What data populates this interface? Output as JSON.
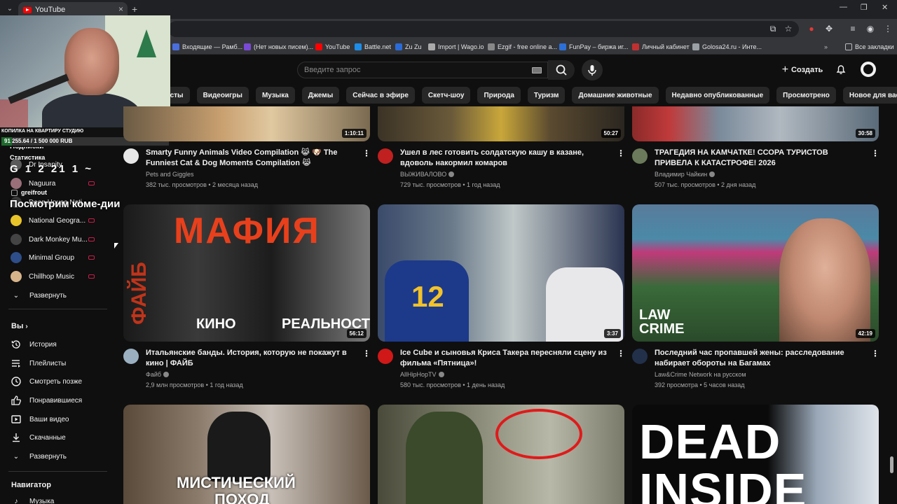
{
  "browser": {
    "tab_title": "YouTube",
    "new_tab": "+",
    "bookmarks": [
      {
        "label": "Входящие — Рамб...",
        "color": "#4a6fdc"
      },
      {
        "label": "(Нет новых писем)...",
        "color": "#7a4ad6"
      },
      {
        "label": "YouTube",
        "color": "#ff0000"
      },
      {
        "label": "Battle.net",
        "color": "#1c8ee8"
      },
      {
        "label": "Zu Zu",
        "color": "#2a6bd8"
      },
      {
        "label": "Import | Wago.io",
        "color": "#aaaaaa"
      },
      {
        "label": "Ezgif - free online a...",
        "color": "#888888"
      },
      {
        "label": "FunPay – биржа иг...",
        "color": "#2c6fd6"
      },
      {
        "label": "Личный кабинет",
        "color": "#c03030"
      },
      {
        "label": "Golosa24.ru - Инте...",
        "color": "#9aa0a6"
      }
    ],
    "all_bookmarks": "Все закладки"
  },
  "header": {
    "search_placeholder": "Введите запрос",
    "create_label": "Создать"
  },
  "chips": [
    "касты",
    "Видеоигры",
    "Музыка",
    "Джемы",
    "Сейчас в эфире",
    "Скетч-шоу",
    "Природа",
    "Туризм",
    "Домашние животные",
    "Недавно опубликованные",
    "Просмотрено",
    "Новое для вас"
  ],
  "overlay": {
    "goal_title": "КОПИЛКА НА КВАРТИРУ СТУДИЮ",
    "goal_amount": "91 255.64 / 1 500 000 RUB",
    "goal_fraction": 0.061,
    "stats_label": "Статистика",
    "stats_digits": "G 1 2 21 1 ~",
    "user_name": "greifrout",
    "big_text": "Посмотрим коме-дии"
  },
  "sidebar": {
    "subscriptions_header": "Подписки",
    "subscriptions": [
      {
        "label": "Dr Insanity",
        "color": "#5a5a5a"
      },
      {
        "label": "Naguura",
        "color": "#9a6f7a"
      },
      {
        "label": "Deep House Nati...",
        "color": "#3a3a3a"
      },
      {
        "label": "National Geogra...",
        "color": "#e8c32a"
      },
      {
        "label": "Dark Monkey Mu...",
        "color": "#444444"
      },
      {
        "label": "Minimal Group",
        "color": "#2d4e8a"
      },
      {
        "label": "Chillhop Music",
        "color": "#d8b48a"
      }
    ],
    "expand_label": "Развернуть",
    "you_section": "Вы",
    "you_items": [
      {
        "label": "История",
        "icon": "history-icon"
      },
      {
        "label": "Плейлисты",
        "icon": "playlists-icon"
      },
      {
        "label": "Смотреть позже",
        "icon": "watch-later-icon"
      },
      {
        "label": "Понравившиеся",
        "icon": "like-icon"
      },
      {
        "label": "Ваши видео",
        "icon": "your-videos-icon"
      },
      {
        "label": "Скачанные",
        "icon": "download-icon"
      },
      {
        "label": "Развернуть",
        "icon": "chevron-down-icon"
      }
    ],
    "navigator_section": "Навигатор",
    "navigator_items": [
      {
        "label": "Музыка",
        "icon": "music-icon"
      }
    ]
  },
  "videos": [
    {
      "title": "Smarty Funny Animals Video Compilation 😹 🐶 The Funniest Cat & Dog Moments Compilation 😹",
      "channel": "Pets and Giggles",
      "verified": false,
      "meta": "382 тыс. просмотров • 2 месяца назад",
      "duration": "1:10:11",
      "avatar": "#e8e8e8"
    },
    {
      "title": "Ушел в лес готовить солдатскую кашу в казане, вдоволь накормил комаров",
      "channel": "ВЫЖИВАЛОВО",
      "verified": true,
      "meta": "729 тыс. просмотров • 1 год назад",
      "duration": "50:27",
      "avatar": "#c02020"
    },
    {
      "title": "ТРАГЕДИЯ НА КАМЧАТКЕ! ССОРА ТУРИСТОВ ПРИВЕЛА К КАТАСТРОФЕ! 2026",
      "channel": "Владимир Чайкин",
      "verified": true,
      "meta": "507 тыс. просмотров • 2 дня назад",
      "duration": "30:58",
      "avatar": "#6a7a5a"
    },
    {
      "title": "Итальянские банды. История, которую не покажут в кино | ФАЙБ",
      "channel": "Файб",
      "verified": true,
      "meta": "2,9 млн просмотров • 1 год назад",
      "duration": "56:12",
      "avatar": "#9ab0c0",
      "thumb_texts": [
        "МАФИЯ",
        "ФАЙБ",
        "КИНО",
        "РЕАЛЬНОСТЬ"
      ]
    },
    {
      "title": "Ice Cube и сыновья Криса Такера пересняли сцену из фильма «Пятница»!",
      "channel": "AllHipHopTV",
      "verified": true,
      "meta": "580 тыс. просмотров • 1 день назад",
      "duration": "3:37",
      "avatar": "#d01818",
      "thumb_texts": [
        "12"
      ]
    },
    {
      "title": "Последний час пропавшей жены: расследование набирает обороты на Багамах",
      "channel": "Law&Crime Network на русском",
      "verified": false,
      "meta": "392 просмотра • 5 часов назад",
      "duration": "42:19",
      "avatar": "#22304a",
      "thumb_texts": [
        "LAW",
        "CRIME"
      ]
    },
    {
      "title": "",
      "channel": "",
      "verified": false,
      "meta": "",
      "duration": "",
      "avatar": "#333333",
      "thumb_texts": [
        "МИСТИЧЕСКИЙ",
        "ПОХОД"
      ]
    },
    {
      "title": "",
      "channel": "",
      "verified": false,
      "meta": "",
      "duration": "",
      "avatar": "#333333"
    },
    {
      "title": "",
      "channel": "",
      "verified": false,
      "meta": "",
      "duration": "",
      "avatar": "#333333",
      "thumb_texts": [
        "DEAD",
        "INSIDE"
      ]
    }
  ]
}
